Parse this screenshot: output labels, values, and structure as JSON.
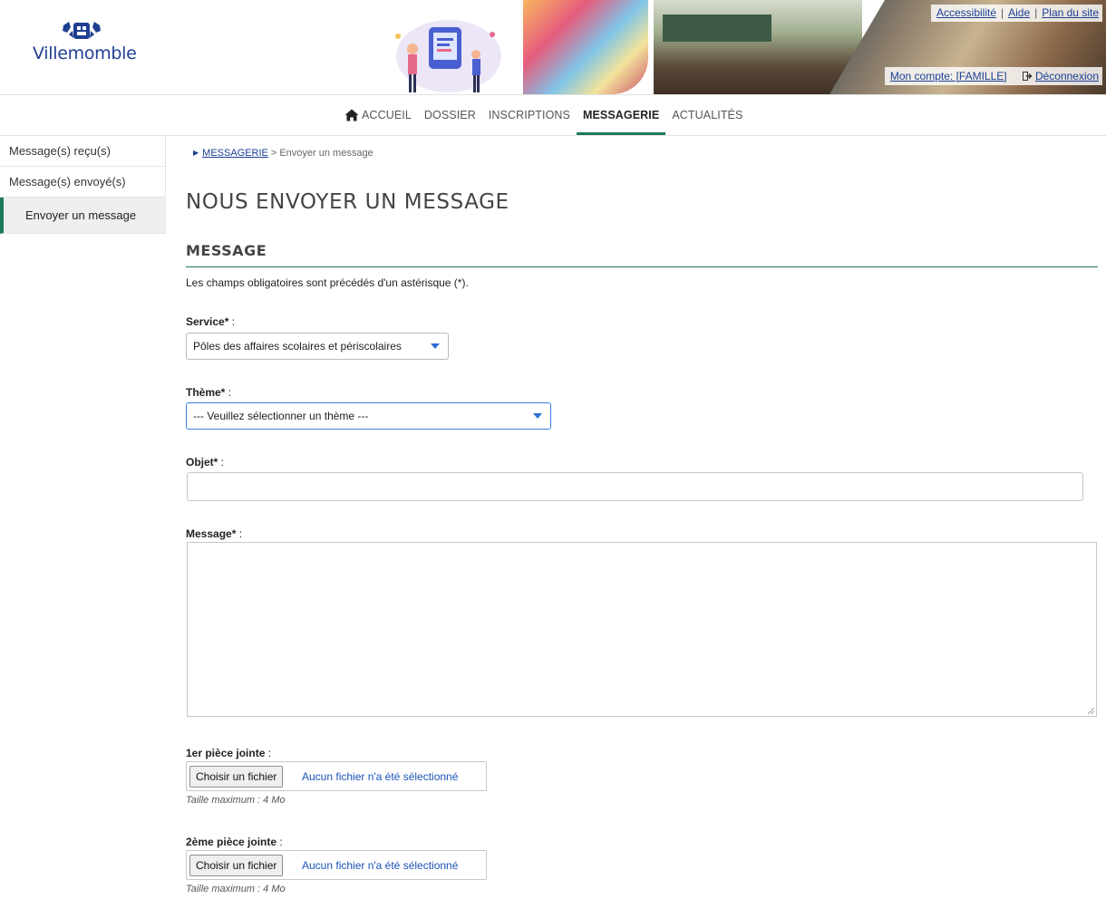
{
  "brand": {
    "logo_text": "Villemomble",
    "accent": "#1d7a5a",
    "link_color": "#1a3f95"
  },
  "toplinks": {
    "accessibility": "Accessibilité",
    "help": "Aide",
    "sitemap": "Plan du site",
    "separator": "|"
  },
  "account": {
    "label": "Mon compte: [FAMILLE]",
    "logout": "Déconnexion",
    "logout_icon": "sign-out-icon"
  },
  "nav": {
    "home_icon": "home-icon",
    "items": [
      {
        "label": "ACCUEIL"
      },
      {
        "label": "DOSSIER"
      },
      {
        "label": "INSCRIPTIONS"
      },
      {
        "label": "MESSAGERIE",
        "active": true
      },
      {
        "label": "ACTUALITÉS"
      }
    ]
  },
  "sidebar": {
    "items": [
      {
        "label": "Message(s) reçu(s)"
      },
      {
        "label": "Message(s) envoyé(s)"
      },
      {
        "label": "Envoyer un message",
        "active": true
      }
    ]
  },
  "breadcrumb": {
    "parent": "MESSAGERIE",
    "separator": ">",
    "current": "Envoyer un message"
  },
  "page": {
    "title": "NOUS ENVOYER UN MESSAGE",
    "section": "MESSAGE",
    "required_note": "Les champs obligatoires sont précédés d'un astérisque (*)."
  },
  "form": {
    "service": {
      "label": "Service*",
      "colon": " :",
      "value": "Pôles des affaires scolaires et périscolaires"
    },
    "theme": {
      "label": "Thème*",
      "colon": " :",
      "value": "--- Veuillez sélectionner un thème ---"
    },
    "objet": {
      "label": "Objet*",
      "colon": " :",
      "value": ""
    },
    "message": {
      "label": "Message*",
      "colon": " :",
      "value": ""
    },
    "attachment1": {
      "label": "1er pièce jointe",
      "colon": " :",
      "button": "Choisir un fichier",
      "status": "Aucun fichier n'a été sélectionné",
      "hint": "Taille maximum : 4 Mo"
    },
    "attachment2": {
      "label": "2ème pièce jointe",
      "colon": " :",
      "button": "Choisir un fichier",
      "status": "Aucun fichier n'a été sélectionné",
      "hint": "Taille maximum : 4 Mo"
    }
  }
}
